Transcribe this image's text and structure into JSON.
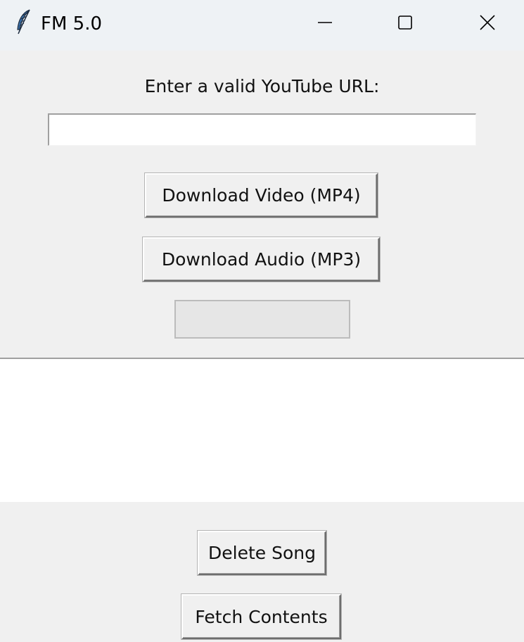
{
  "window": {
    "title": "FM 5.0",
    "icon": "feather-icon"
  },
  "controls": {
    "minimize_icon": "minimize-icon",
    "maximize_icon": "maximize-icon",
    "close_icon": "close-icon"
  },
  "form": {
    "prompt": "Enter a valid YouTube URL:",
    "url_value": "",
    "url_placeholder": ""
  },
  "buttons": {
    "download_video": "Download Video (MP4)",
    "download_audio": "Download Audio (MP3)",
    "delete_song": "Delete Song",
    "fetch_contents": "Fetch Contents"
  },
  "progress": {
    "value": 0
  },
  "song_list": {
    "items": []
  },
  "colors": {
    "window_bg": "#f0f0f0",
    "titlebar_bg": "#eef2f5",
    "listbox_bg": "#ffffff"
  }
}
